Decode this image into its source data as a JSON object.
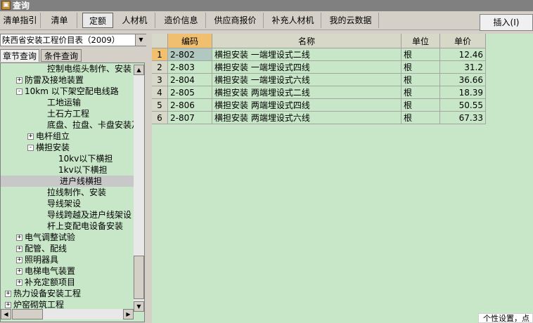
{
  "window": {
    "title": "查询"
  },
  "tabs": [
    {
      "label": "清单指引"
    },
    {
      "label": "清单"
    },
    {
      "label": "定额"
    },
    {
      "label": "人材机"
    },
    {
      "label": "造价信息"
    },
    {
      "label": "供应商报价"
    },
    {
      "label": "补充人材机"
    },
    {
      "label": "我的云数据"
    }
  ],
  "insert_button": "插入(I)",
  "library_select": "陕西省安装工程价目表（2009）",
  "subtabs": [
    {
      "label": "章节查询"
    },
    {
      "label": "条件查询"
    }
  ],
  "tree": [
    {
      "text": "控制电缆头制作、安装",
      "expander": ""
    },
    {
      "text": "防雷及接地装置",
      "expander": "+"
    },
    {
      "text": "10km 以下架空配电线路",
      "expander": "−"
    },
    {
      "text": "工地运输",
      "expander": ""
    },
    {
      "text": "土石方工程",
      "expander": ""
    },
    {
      "text": "底盘、拉盘、卡盘安装及",
      "expander": ""
    },
    {
      "text": "电杆组立",
      "expander": "+"
    },
    {
      "text": "横担安装",
      "expander": "−"
    },
    {
      "text": "10kv以下横担",
      "expander": ""
    },
    {
      "text": "1kv以下横担",
      "expander": ""
    },
    {
      "text": "进户线横担",
      "expander": ""
    },
    {
      "text": "拉线制作、安装",
      "expander": ""
    },
    {
      "text": "导线架设",
      "expander": ""
    },
    {
      "text": "导线跨越及进户线架设",
      "expander": ""
    },
    {
      "text": "杆上变配电设备安装",
      "expander": ""
    },
    {
      "text": "电气调整试验",
      "expander": "+"
    },
    {
      "text": "配管、配线",
      "expander": "+"
    },
    {
      "text": "照明器具",
      "expander": "+"
    },
    {
      "text": "电梯电气装置",
      "expander": "+"
    },
    {
      "text": "补充定额项目",
      "expander": "+"
    },
    {
      "text": "热力设备安装工程",
      "expander": "+"
    },
    {
      "text": "炉窑砌筑工程",
      "expander": "+"
    }
  ],
  "table": {
    "headers": [
      "编码",
      "名称",
      "单位",
      "单价"
    ],
    "rows": [
      {
        "n": "1",
        "code": "2-802",
        "name": "横担安装 一端埋设式二线",
        "unit": "根",
        "price": "12.46"
      },
      {
        "n": "2",
        "code": "2-803",
        "name": "横担安装 一端埋设式四线",
        "unit": "根",
        "price": "31.2"
      },
      {
        "n": "3",
        "code": "2-804",
        "name": "横担安装 一端埋设式六线",
        "unit": "根",
        "price": "36.66"
      },
      {
        "n": "4",
        "code": "2-805",
        "name": "横担安装 两端埋设式二线",
        "unit": "根",
        "price": "18.39"
      },
      {
        "n": "5",
        "code": "2-806",
        "name": "横担安装 两端埋设式四线",
        "unit": "根",
        "price": "50.55"
      },
      {
        "n": "6",
        "code": "2-807",
        "name": "横担安装 两端埋设式六线",
        "unit": "根",
        "price": "67.33"
      }
    ]
  },
  "tooltip": "个性设置，点"
}
